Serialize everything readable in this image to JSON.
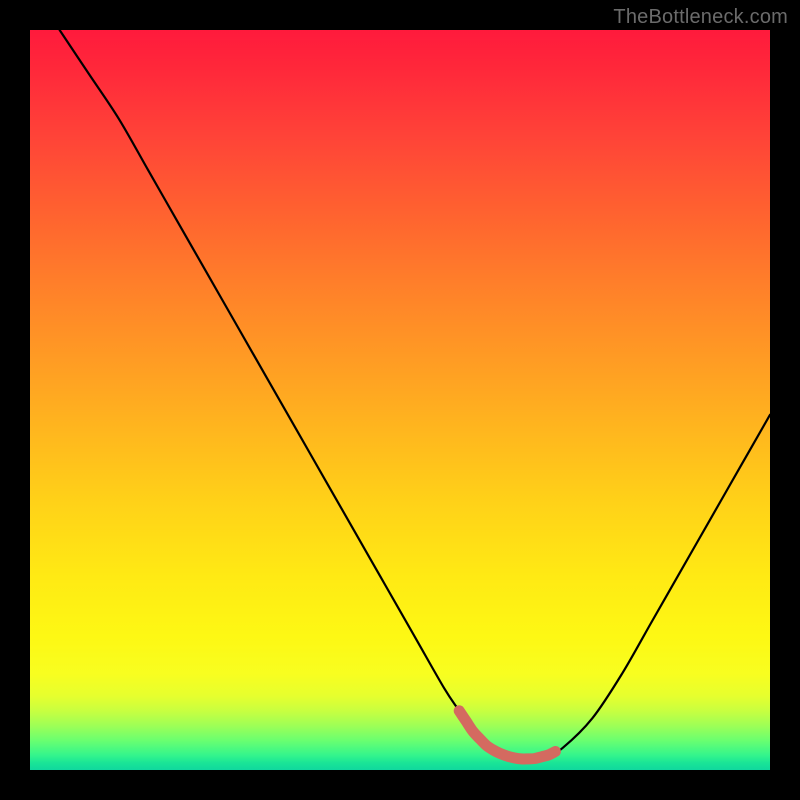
{
  "watermark": "TheBottleneck.com",
  "chart_data": {
    "type": "line",
    "title": "",
    "xlabel": "",
    "ylabel": "",
    "xlim": [
      0,
      100
    ],
    "ylim": [
      0,
      100
    ],
    "series": [
      {
        "name": "bottleneck-curve",
        "x": [
          4,
          8,
          12,
          16,
          20,
          24,
          28,
          32,
          36,
          40,
          44,
          48,
          52,
          56,
          58,
          60,
          62,
          64,
          66,
          68,
          70,
          72,
          76,
          80,
          84,
          88,
          92,
          96,
          100
        ],
        "values": [
          100,
          94,
          88,
          81,
          74,
          67,
          60,
          53,
          46,
          39,
          32,
          25,
          18,
          11,
          8,
          5,
          3,
          2,
          1.5,
          1.5,
          2,
          3,
          7,
          13,
          20,
          27,
          34,
          41,
          48
        ]
      }
    ],
    "highlight": {
      "name": "optimal-range",
      "x_start": 58,
      "x_end": 71,
      "color": "#d46a60"
    },
    "gradient_stops": [
      {
        "pos": 0,
        "color": "#ff1a3c"
      },
      {
        "pos": 50,
        "color": "#ffc81c"
      },
      {
        "pos": 85,
        "color": "#f8fe20"
      },
      {
        "pos": 100,
        "color": "#10d89e"
      }
    ]
  }
}
